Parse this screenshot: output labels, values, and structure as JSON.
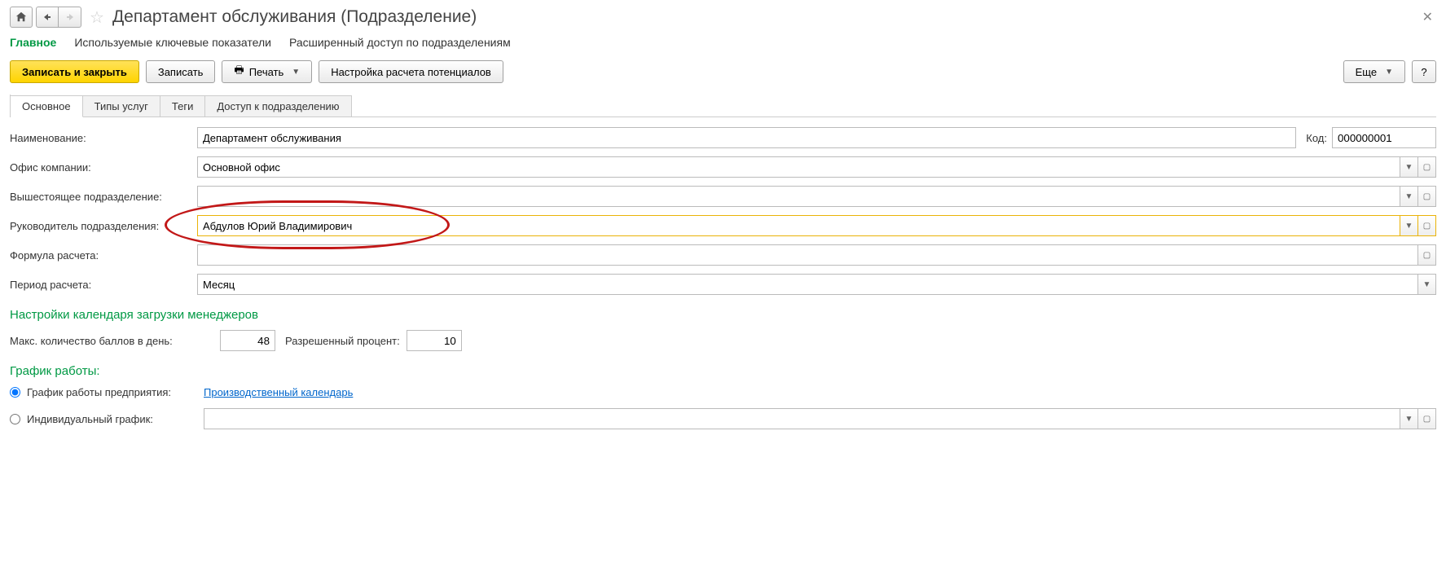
{
  "header": {
    "title": "Департамент обслуживания (Подразделение)"
  },
  "menu": {
    "main": "Главное",
    "kpi": "Используемые ключевые показатели",
    "access": "Расширенный доступ по подразделениям"
  },
  "toolbar": {
    "save_close": "Записать и закрыть",
    "save": "Записать",
    "print": "Печать",
    "potentials": "Настройка расчета потенциалов",
    "more": "Еще",
    "help": "?"
  },
  "tabs": {
    "main": "Основное",
    "services": "Типы услуг",
    "tags": "Теги",
    "access": "Доступ к подразделению"
  },
  "form": {
    "name_label": "Наименование:",
    "name_value": "Департамент обслуживания",
    "code_label": "Код:",
    "code_value": "000000001",
    "office_label": "Офис компании:",
    "office_value": "Основной офис",
    "parent_label": "Вышестоящее подразделение:",
    "parent_value": "",
    "head_label": "Руководитель подразделения:",
    "head_value": "Абдулов Юрий Владимирович",
    "formula_label": "Формула расчета:",
    "formula_value": "",
    "period_label": "Период расчета:",
    "period_value": "Месяц"
  },
  "calendar": {
    "section_title": "Настройки календаря загрузки менеджеров",
    "max_points_label": "Макс. количество баллов в день:",
    "max_points_value": "48",
    "percent_label": "Разрешенный процент:",
    "percent_value": "10"
  },
  "schedule": {
    "section_title": "График работы:",
    "company_label": "График работы предприятия:",
    "company_link": "Производственный календарь",
    "individual_label": "Индивидуальный график:",
    "individual_value": ""
  }
}
